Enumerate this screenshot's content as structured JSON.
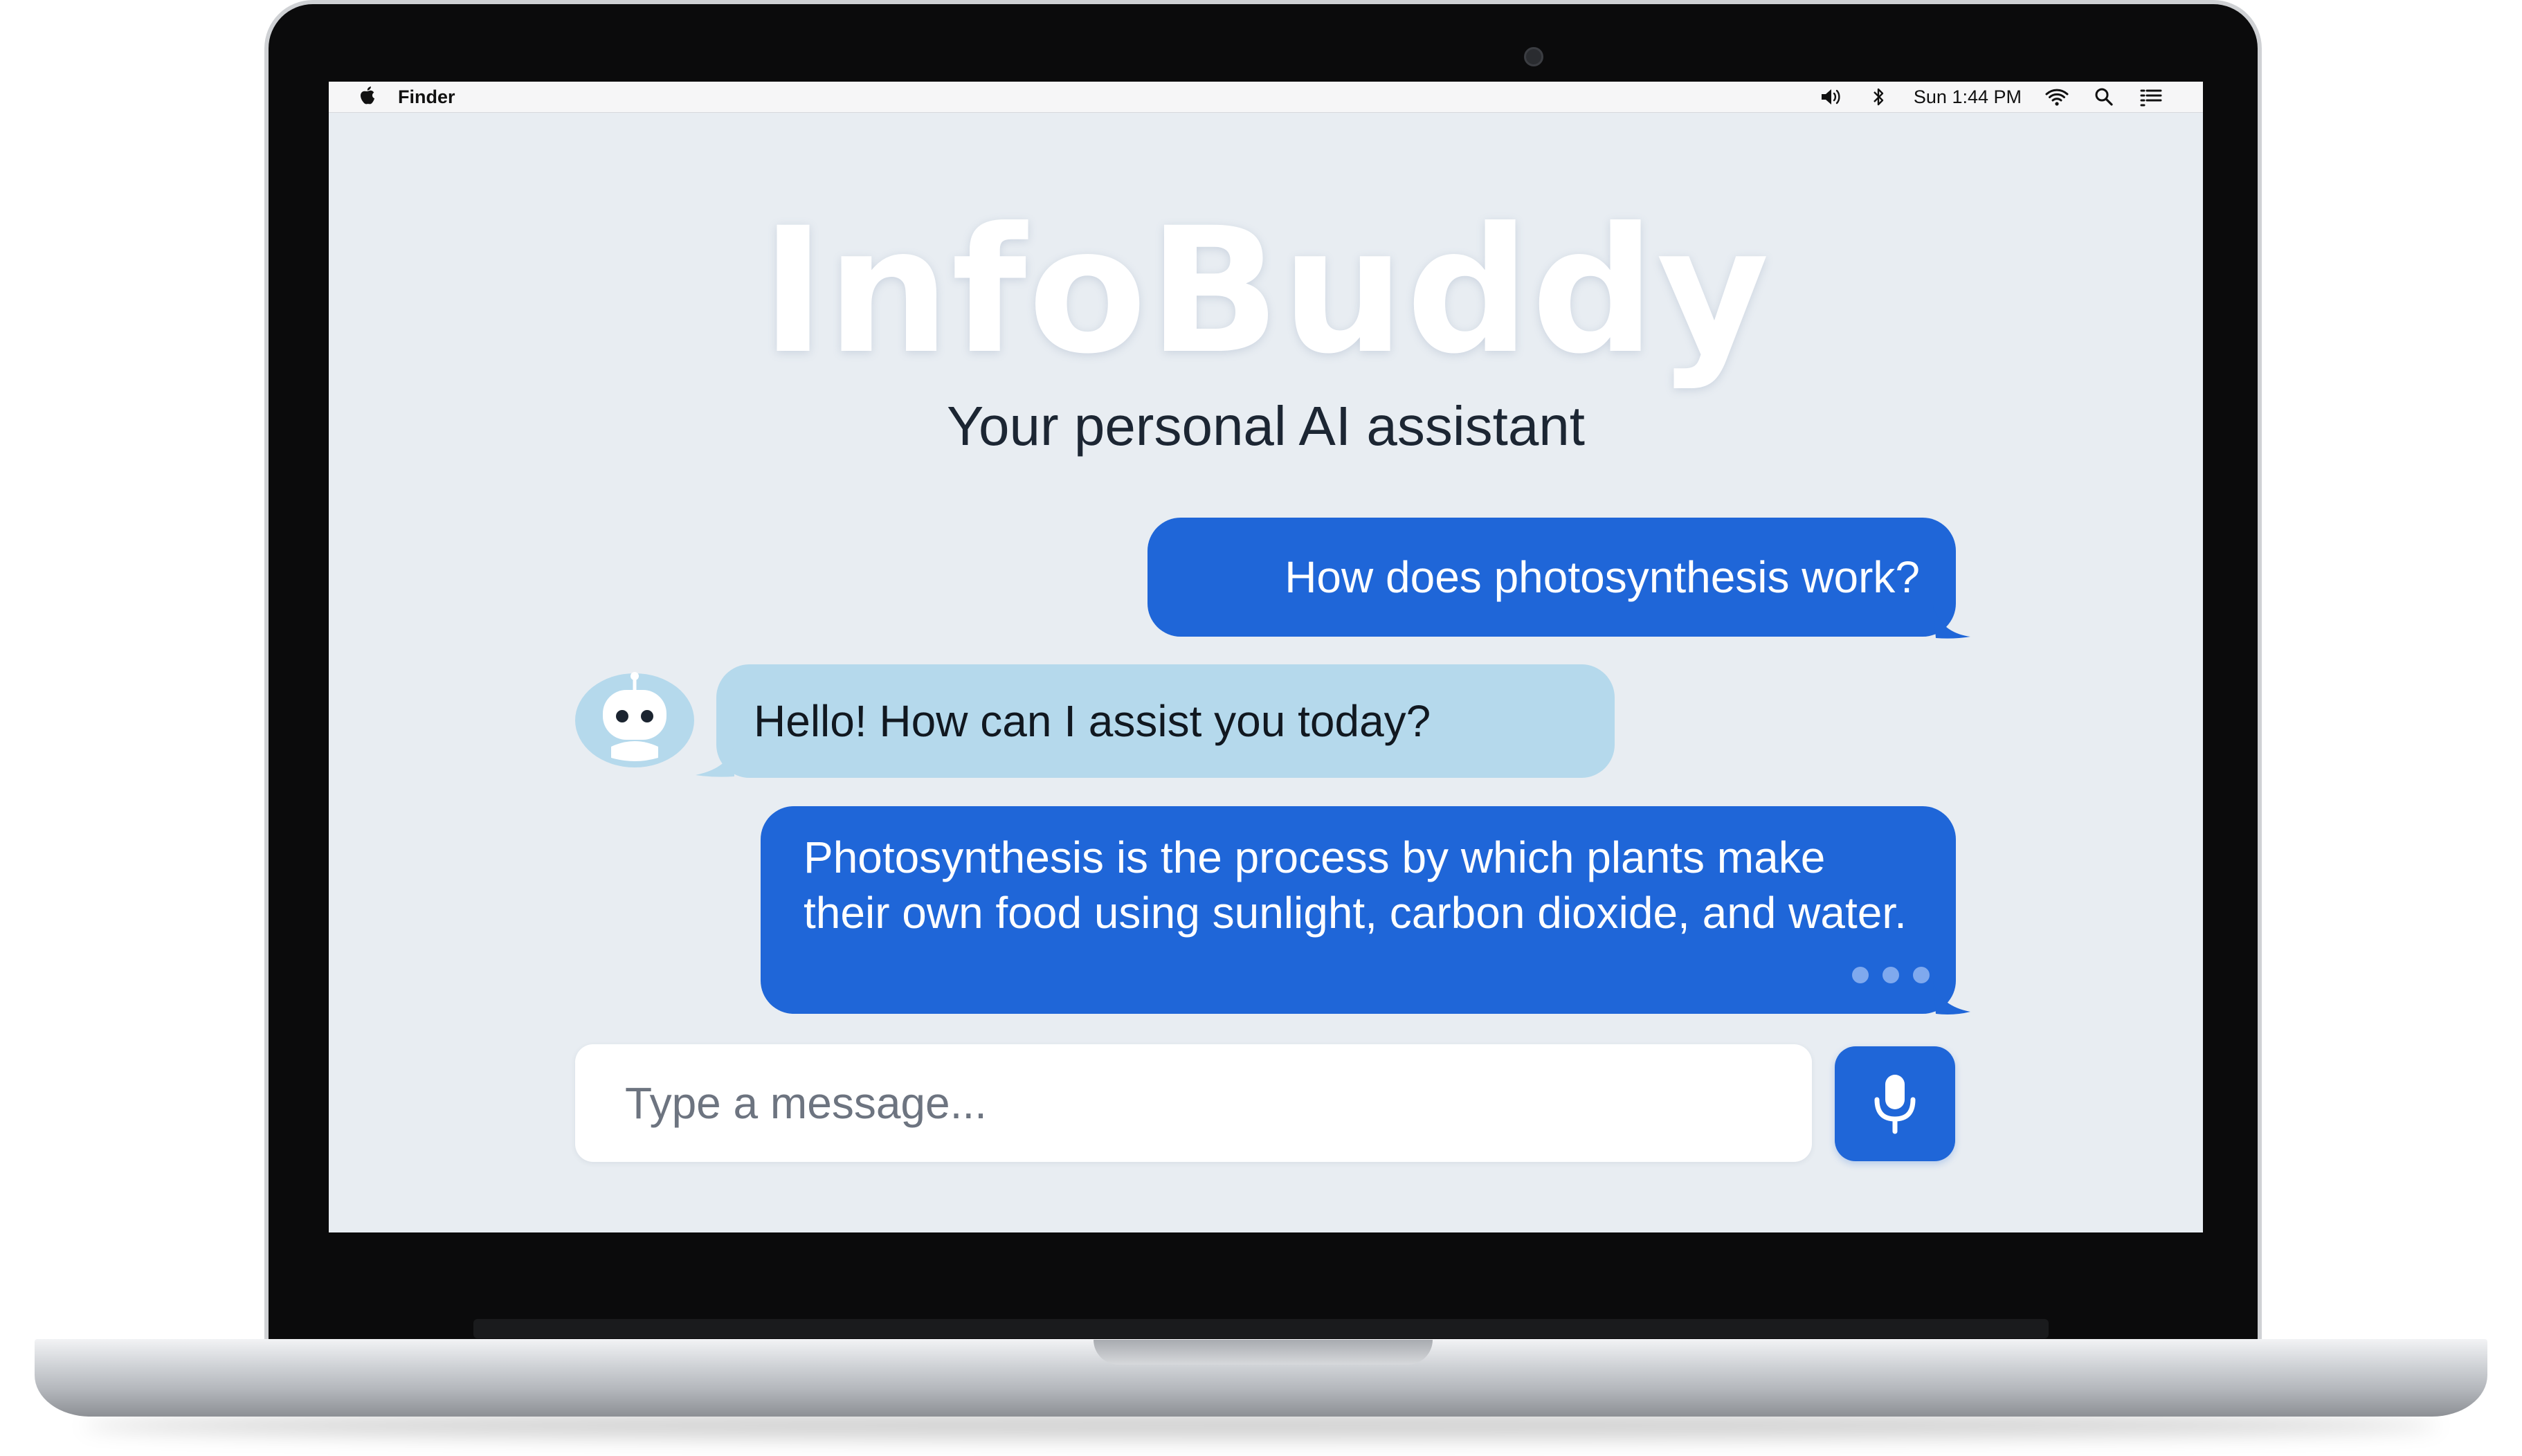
{
  "menubar": {
    "app_name": "Finder",
    "clock": "Sun 1:44 PM",
    "icons": [
      "apple-icon",
      "volume-icon",
      "bluetooth-icon",
      "wifi-icon",
      "search-icon",
      "list-icon"
    ]
  },
  "app": {
    "brand": "InfoBuddy",
    "subtitle": "Your personal AI assistant"
  },
  "messages": [
    {
      "sender": "user",
      "text": "How does photosynthesis work?"
    },
    {
      "sender": "bot",
      "text": "Hello! How can I assist you today?"
    },
    {
      "sender": "user",
      "text": "Photosynthesis is the process by which plants make their own food using sunlight, carbon dioxide, and water."
    }
  ],
  "composer": {
    "placeholder": "Type a message...",
    "mic_icon": "microphone-icon"
  },
  "colors": {
    "user_bubble": "#1f66d8",
    "bot_bubble": "#b5d9ec",
    "background": "#e8edf2"
  }
}
